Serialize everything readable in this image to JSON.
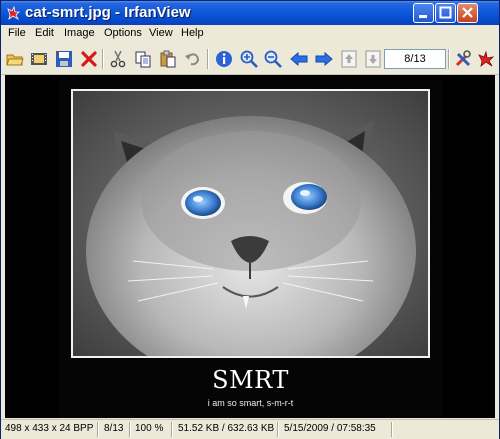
{
  "window": {
    "title": "cat-smrt.jpg - IrfanView"
  },
  "menu": [
    "File",
    "Edit",
    "Image",
    "Options",
    "View",
    "Help"
  ],
  "toolbar": {
    "page_indicator": "8/13",
    "buttons": [
      "open-icon",
      "slideshow-icon",
      "save-icon",
      "delete-icon",
      "cut-icon",
      "copy-icon",
      "paste-icon",
      "undo-icon",
      "info-icon",
      "zoom-in-icon",
      "zoom-out-icon",
      "previous-icon",
      "next-icon",
      "first-file-icon",
      "last-file-icon",
      "settings-icon",
      "irfanview-icon"
    ]
  },
  "image": {
    "title": "SMRT",
    "caption": "i am so smart, s-m-r-t"
  },
  "status": {
    "dimensions": "498 x 433 x 24 BPP",
    "index": "8/13",
    "zoom": "100 %",
    "size": "51.52 KB / 632.63 KB",
    "datetime": "5/15/2009 / 07:58:35"
  }
}
